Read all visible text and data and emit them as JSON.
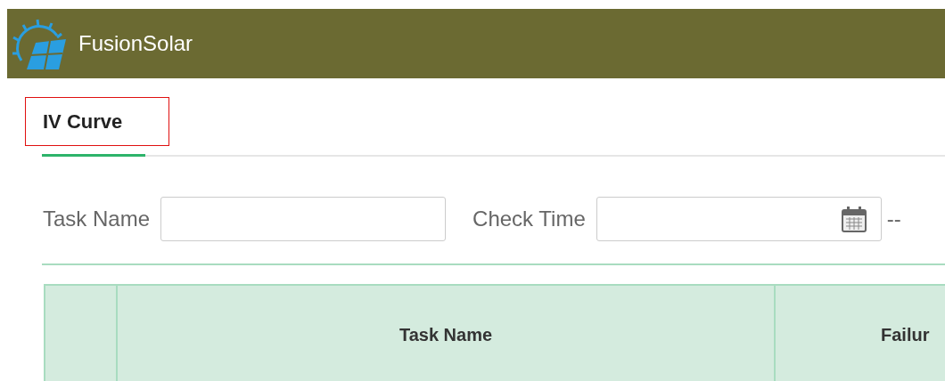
{
  "header": {
    "title": "FusionSolar"
  },
  "tabs": [
    {
      "label": "IV Curve",
      "selected": true
    }
  ],
  "filters": [
    {
      "kind": "text",
      "label": "Task Name"
    },
    {
      "kind": "date",
      "label": "Check Time",
      "separator": "--"
    }
  ],
  "table": {
    "columns": [
      "",
      "Task Name",
      "Failur"
    ]
  }
}
